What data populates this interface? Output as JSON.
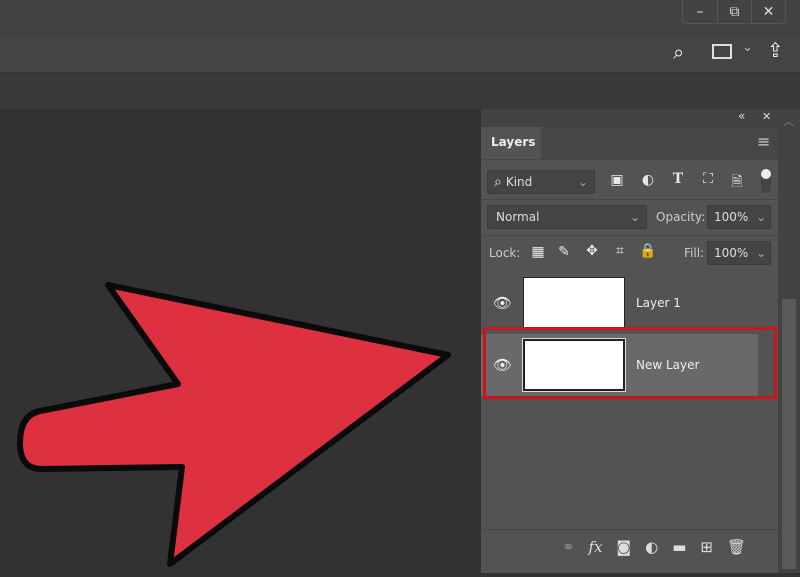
{
  "window": {
    "minimize": "–",
    "restore": "⧉",
    "close": "✕"
  },
  "options_bar": {
    "search": "⌕",
    "workspace": "▭",
    "workspace_chevron": "⌄",
    "share": "⇪"
  },
  "layers_panel": {
    "collapse": "«",
    "close": "✕",
    "tab": "Layers",
    "menu": "≡",
    "filter": {
      "label": "Kind",
      "search_icon": "⌕",
      "chevron": "⌄"
    },
    "blend_mode": "Normal",
    "opacity_label": "Opacity:",
    "opacity": "100%",
    "lock_label": "Lock:",
    "fill_label": "Fill:",
    "fill": "100%",
    "layers": [
      {
        "name": "Layer 1",
        "visible": true,
        "selected": false
      },
      {
        "name": "New Layer",
        "visible": true,
        "selected": true
      }
    ],
    "highlight_color": "#d0131b"
  },
  "canvas": {
    "arrow_color": "#dd3140"
  }
}
